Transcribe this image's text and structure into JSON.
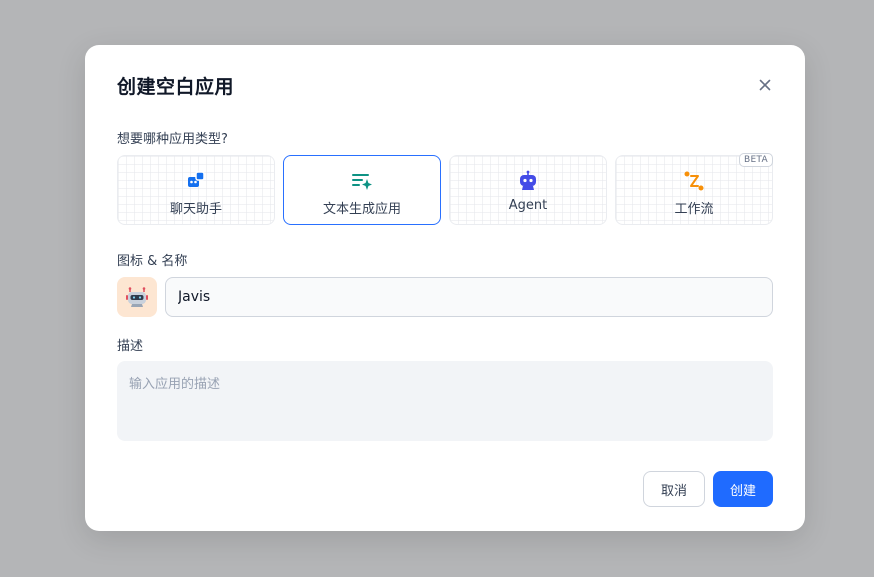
{
  "dialog": {
    "title": "创建空白应用",
    "close_icon": "close-icon"
  },
  "type_section": {
    "label": "想要哪种应用类型?",
    "types": [
      {
        "label": "聊天助手",
        "icon": "chat-assistant-icon",
        "color": "#1570ef",
        "selected": false
      },
      {
        "label": "文本生成应用",
        "icon": "text-generation-icon",
        "color": "#0e9384",
        "selected": true
      },
      {
        "label": "Agent",
        "icon": "robot-icon",
        "color": "#444ce7",
        "selected": false
      },
      {
        "label": "工作流",
        "icon": "workflow-icon",
        "color": "#f79009",
        "selected": false,
        "badge": "BETA"
      }
    ]
  },
  "icon_name": {
    "label": "图标 & 名称",
    "avatar_icon": "robot-avatar-icon",
    "value": "Javis",
    "placeholder": ""
  },
  "description": {
    "label": "描述",
    "value": "",
    "placeholder": "输入应用的描述"
  },
  "footer": {
    "cancel_label": "取消",
    "create_label": "创建"
  },
  "colors": {
    "primary": "#1f6bff",
    "overlay": "#b4b5b7",
    "selected_border": "#2970ff"
  }
}
